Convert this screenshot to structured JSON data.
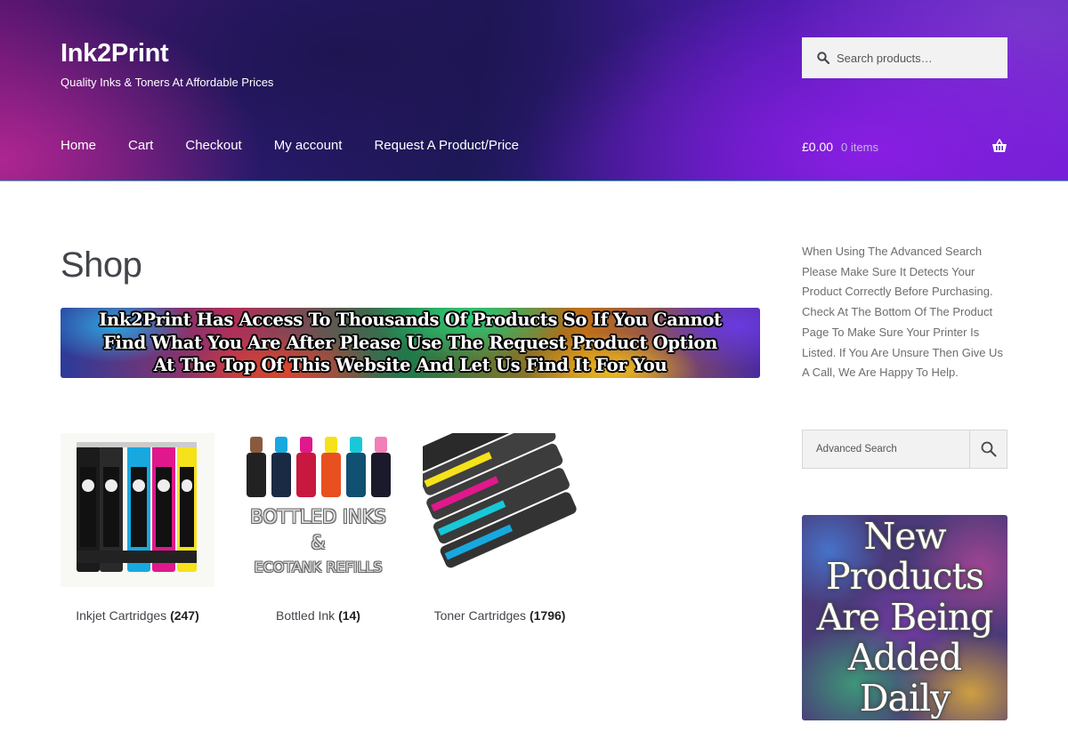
{
  "header": {
    "site_title": "Ink2Print",
    "tagline": "Quality Inks & Toners At Affordable Prices",
    "search_placeholder": "Search products…",
    "nav": [
      "Home",
      "Cart",
      "Checkout",
      "My account",
      "Request A Product/Price"
    ],
    "cart_amount": "£0.00",
    "cart_count": "0 items"
  },
  "main": {
    "page_title": "Shop",
    "banner_lines": [
      "Ink2Print Has Access To Thousands Of Products So If You Cannot",
      "Find What You Are After Please Use The Request Product Option",
      "At The Top Of This Website And Let Us Find It For You"
    ],
    "categories": [
      {
        "name": "Inkjet Cartridges",
        "count": "(247)"
      },
      {
        "name": "Bottled Ink",
        "count": "(14)"
      },
      {
        "name": "Toner Cartridges",
        "count": "(1796)"
      }
    ],
    "bottled_image_text": {
      "line1": "BOTTLED INKS",
      "line2": "&",
      "line3": "ECOTANK REFILLS"
    }
  },
  "sidebar": {
    "help_text": "When Using The Advanced Search Please Make Sure It Detects Your Product Correctly Before Purchasing. Check At The Bottom Of The Product Page To Make Sure Your Printer Is Listed. If You Are Unsure Then Give Us A Call, We Are Happy To Help.",
    "advanced_search_placeholder": "Advanced Search",
    "promo_lines": [
      "New",
      "Products",
      "Are Being",
      "Added",
      "Daily"
    ]
  },
  "colors": {
    "header_accent": "#45c9c9",
    "cart_magenta": "#e0188c",
    "cart_cyan": "#18a8e0",
    "cart_yellow": "#f5e21a"
  }
}
